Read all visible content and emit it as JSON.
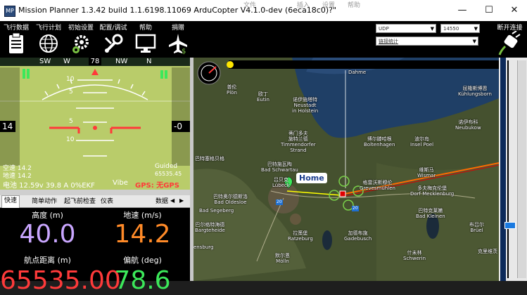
{
  "window": {
    "title": "Mission Planner 1.3.42 build 1.1.6198.11069 ArduCopter V4.1.0-dev (6eca18c0)?\"",
    "background_menu": [
      "文件",
      "插入",
      "设置",
      "帮助"
    ],
    "controls": {
      "minimize": "—",
      "maximize": "☐",
      "close": "✕"
    }
  },
  "toolbar": {
    "items": [
      {
        "label": "飞行数据",
        "icon": "clipboard-icon"
      },
      {
        "label": "飞行计划",
        "icon": "globe-icon"
      },
      {
        "label": "初始设置",
        "icon": "gears-icon"
      },
      {
        "label": "配置/调试",
        "icon": "wrench-icon"
      },
      {
        "label": "帮助",
        "icon": "monitor-icon"
      },
      {
        "label": "捐赠",
        "icon": "plane-icon"
      }
    ],
    "connection": {
      "port": "UDP",
      "baud": "14550",
      "stats_link": "链接统计",
      "connect_label": "断开连接"
    }
  },
  "hud": {
    "heading_ticks": [
      "SW",
      "W",
      "NW",
      "N"
    ],
    "heading_value": "78",
    "ground_speed": "14",
    "altitude": "-0",
    "airspeed_line": "空速 14.2",
    "groundspeed_line": "地速 14.2",
    "mode": "Guided",
    "distance": "65535.45",
    "battery": "电池 12.59v 39.8 A 0%EKF",
    "vibe": "Vibe",
    "gps": "GPS: 无GPS",
    "pitch_ladder": [
      "10",
      "5",
      "5",
      "10"
    ]
  },
  "tabs": [
    "快速",
    "简单动作",
    "起飞前检查",
    "仪表",
    "数据"
  ],
  "quick": [
    {
      "label": "高度 (m)",
      "value": "40.0",
      "color": "#c9a6ff"
    },
    {
      "label": "地速 (m/s)",
      "value": "14.2",
      "color": "#ff8a28"
    },
    {
      "label": "航点距离 (m)",
      "value": "65535.00",
      "color": "#ff3a3a"
    },
    {
      "label": "偏航 (deg)",
      "value": "78.6",
      "color": "#3ce85a"
    }
  ],
  "map": {
    "home_label": "Home",
    "places": [
      {
        "id": "dahme",
        "text": "Dahme"
      },
      {
        "id": "plon",
        "text": "普伦\nPlön"
      },
      {
        "id": "neustadt",
        "text": "诺伊施塔特\nNeustadt\nin Holstein"
      },
      {
        "id": "eutin",
        "text": "欧丁\nEutin"
      },
      {
        "id": "timmendorf",
        "text": "蒂门多夫\n施特兰德\nTimmendorfer\nStrand"
      },
      {
        "id": "boltenhagen",
        "text": "博尔滕哈根\nBoltenhagen"
      },
      {
        "id": "insel-poel",
        "text": "波尔岛\nInsel Poel"
      },
      {
        "id": "kuhlungsborn",
        "text": "屈隆斯博恩\nKühlungsborn"
      },
      {
        "id": "neubukow",
        "text": "诺伊布科\nNeubukow"
      },
      {
        "id": "segeberg",
        "text": "巴特塞格贝格"
      },
      {
        "id": "bad-schwartau",
        "text": "巴特施瓦陶\nBad Schwartau"
      },
      {
        "id": "lubeck",
        "text": "吕贝克\nLübeck"
      },
      {
        "id": "grevesmuhlen",
        "text": "格雷沃斯穆伦\nGrevesmühlen"
      },
      {
        "id": "wismar",
        "text": "维斯马\nWismar"
      },
      {
        "id": "dorf-mecklenburg",
        "text": "多夫梅克伦堡\nDorf Mecklenburg"
      },
      {
        "id": "bad-kleinen",
        "text": "巴特克莱嫩\nBad Kleinen"
      },
      {
        "id": "bad-oldesloe",
        "text": "巴特奥尔德斯洛\nBad Oldesloe"
      },
      {
        "id": "bargteheide",
        "text": "巴尔格特海德\nBargteheide"
      },
      {
        "id": "ratzeburg",
        "text": "拉策堡\nRatzeburg"
      },
      {
        "id": "gadebusch",
        "text": "加德布施\nGadebusch"
      },
      {
        "id": "schwerin",
        "text": "什未林\nSchwerin"
      },
      {
        "id": "brüel",
        "text": "布吕尔\nBrüel"
      },
      {
        "id": "bad-segeberg",
        "text": "Bad Segeberg"
      },
      {
        "id": "ensburg",
        "text": "ensburg"
      },
      {
        "id": "molln",
        "text": "默尔恩\nMölln"
      },
      {
        "id": "crivitz",
        "text": "克里维茨"
      }
    ],
    "road_labels": [
      "20",
      "20"
    ]
  },
  "colors": {
    "hud_ground": "#b9cc6a",
    "toolbar_bg": "#000000",
    "track_line": "#ff6a00"
  }
}
